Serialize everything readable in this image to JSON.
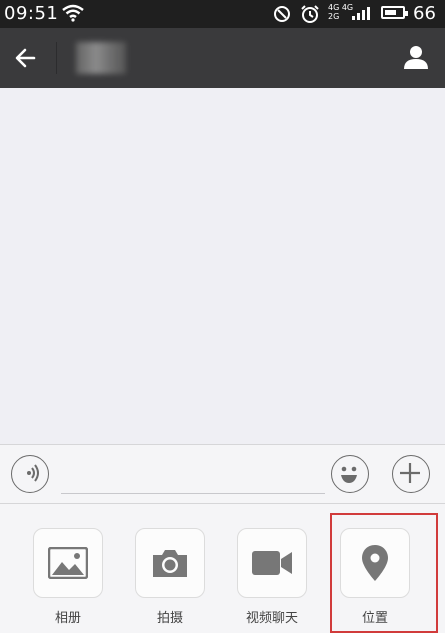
{
  "status_bar": {
    "time": "09:51",
    "battery": "66",
    "battery_level": 0.66,
    "network_top": "4G 4G",
    "network_bottom": "2G"
  },
  "header": {
    "title": ""
  },
  "input": {
    "placeholder": "",
    "value": ""
  },
  "tools": [
    {
      "label": "相册",
      "icon": "photo-icon"
    },
    {
      "label": "拍摄",
      "icon": "camera-icon"
    },
    {
      "label": "视频聊天",
      "icon": "video-icon"
    },
    {
      "label": "位置",
      "icon": "location-pin-icon"
    }
  ],
  "colors": {
    "statusbar": "#1f1f1f",
    "titlebar": "#3a3a3c",
    "background": "#efeff4",
    "highlight": "#d13b3b",
    "icon": "#777777"
  }
}
